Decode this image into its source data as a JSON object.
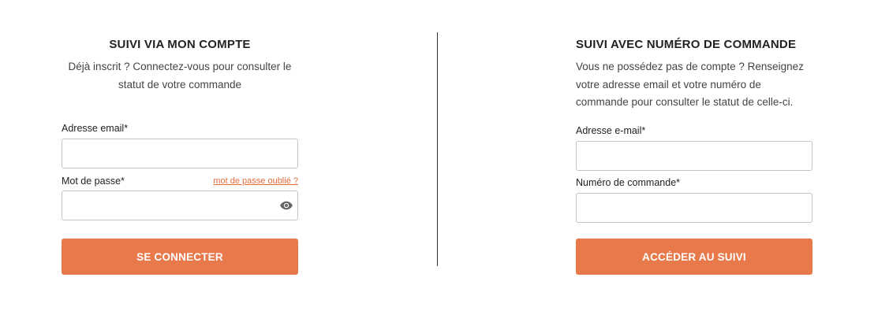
{
  "account_panel": {
    "title": "SUIVI VIA MON COMPTE",
    "description": "Déjà inscrit ? Connectez-vous pour consulter le statut de votre commande",
    "email_label": "Adresse email*",
    "email_value": "",
    "password_label": "Mot de passe*",
    "password_value": "",
    "forgot_password_link": "mot de passe oublié ?",
    "password_toggle_icon": "eye-icon",
    "submit_label": "SE CONNECTER"
  },
  "order_panel": {
    "title": "SUIVI AVEC NUMÉRO DE COMMANDE",
    "description": "Vous ne possédez pas de compte ? Renseignez votre adresse email et votre numéro de commande pour consulter le statut de celle-ci.",
    "email_label": "Adresse e-mail*",
    "email_value": "",
    "order_number_label": "Numéro de commande*",
    "order_number_value": "",
    "submit_label": "ACCÉDER AU SUIVI"
  },
  "colors": {
    "accent": "#e8794a",
    "link": "#e36b3a",
    "input_border": "#c4c4c4",
    "divider": "#333333"
  }
}
